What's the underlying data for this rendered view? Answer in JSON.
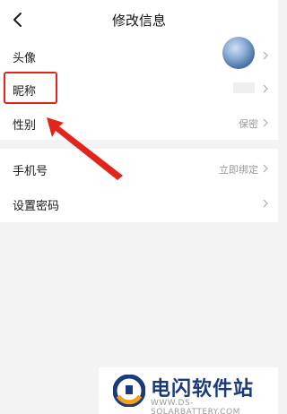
{
  "header": {
    "title": "修改信息",
    "back_icon": "chevron-left-icon"
  },
  "profile": {
    "avatar_label": "头像",
    "nickname_label": "昵称",
    "gender_label": "性别",
    "gender_value": "保密"
  },
  "account": {
    "phone_label": "手机号",
    "phone_value": "立即绑定",
    "password_label": "设置密码"
  },
  "colors": {
    "highlight": "#e3241b",
    "accent_blue": "#1a3a7a",
    "accent_orange": "#f0a020"
  },
  "watermark": {
    "title": "电闪软件站",
    "url": "WWW.DS-SOLARBATTERY.COM"
  }
}
